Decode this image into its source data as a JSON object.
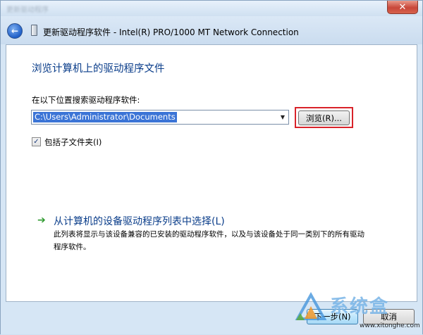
{
  "window": {
    "blurred_caption": "更新驱动程序",
    "title": "更新驱动程序软件 - Intel(R) PRO/1000 MT Network Connection",
    "close_symbol": "✕",
    "back_symbol": "←"
  },
  "main": {
    "heading": "浏览计算机上的驱动程序文件",
    "search_label": "在以下位置搜索驱动程序软件:",
    "path_value": "C:\\Users\\Administrator\\Documents",
    "dropdown_arrow": "▼",
    "browse_label": "浏览(R)...",
    "include_subfolders": {
      "label": "包括子文件夹(I)",
      "checked": true,
      "check_mark": "✓"
    },
    "pick_option": {
      "arrow": "➔",
      "title": "从计算机的设备驱动程序列表中选择(L)",
      "description": "此列表将显示与该设备兼容的已安装的驱动程序软件，以及与该设备处于同一类别下的所有驱动程序软件。"
    }
  },
  "footer": {
    "next_label": "下一步(N)",
    "cancel_label": "取消"
  },
  "watermark": {
    "brand": "系统盒",
    "url": "www.xitonghe.com"
  },
  "colors": {
    "accent_blue": "#0a3d8a",
    "highlight_red": "#d9232a",
    "selection_blue": "#3b74d6",
    "frame": "#d6e6f5"
  }
}
